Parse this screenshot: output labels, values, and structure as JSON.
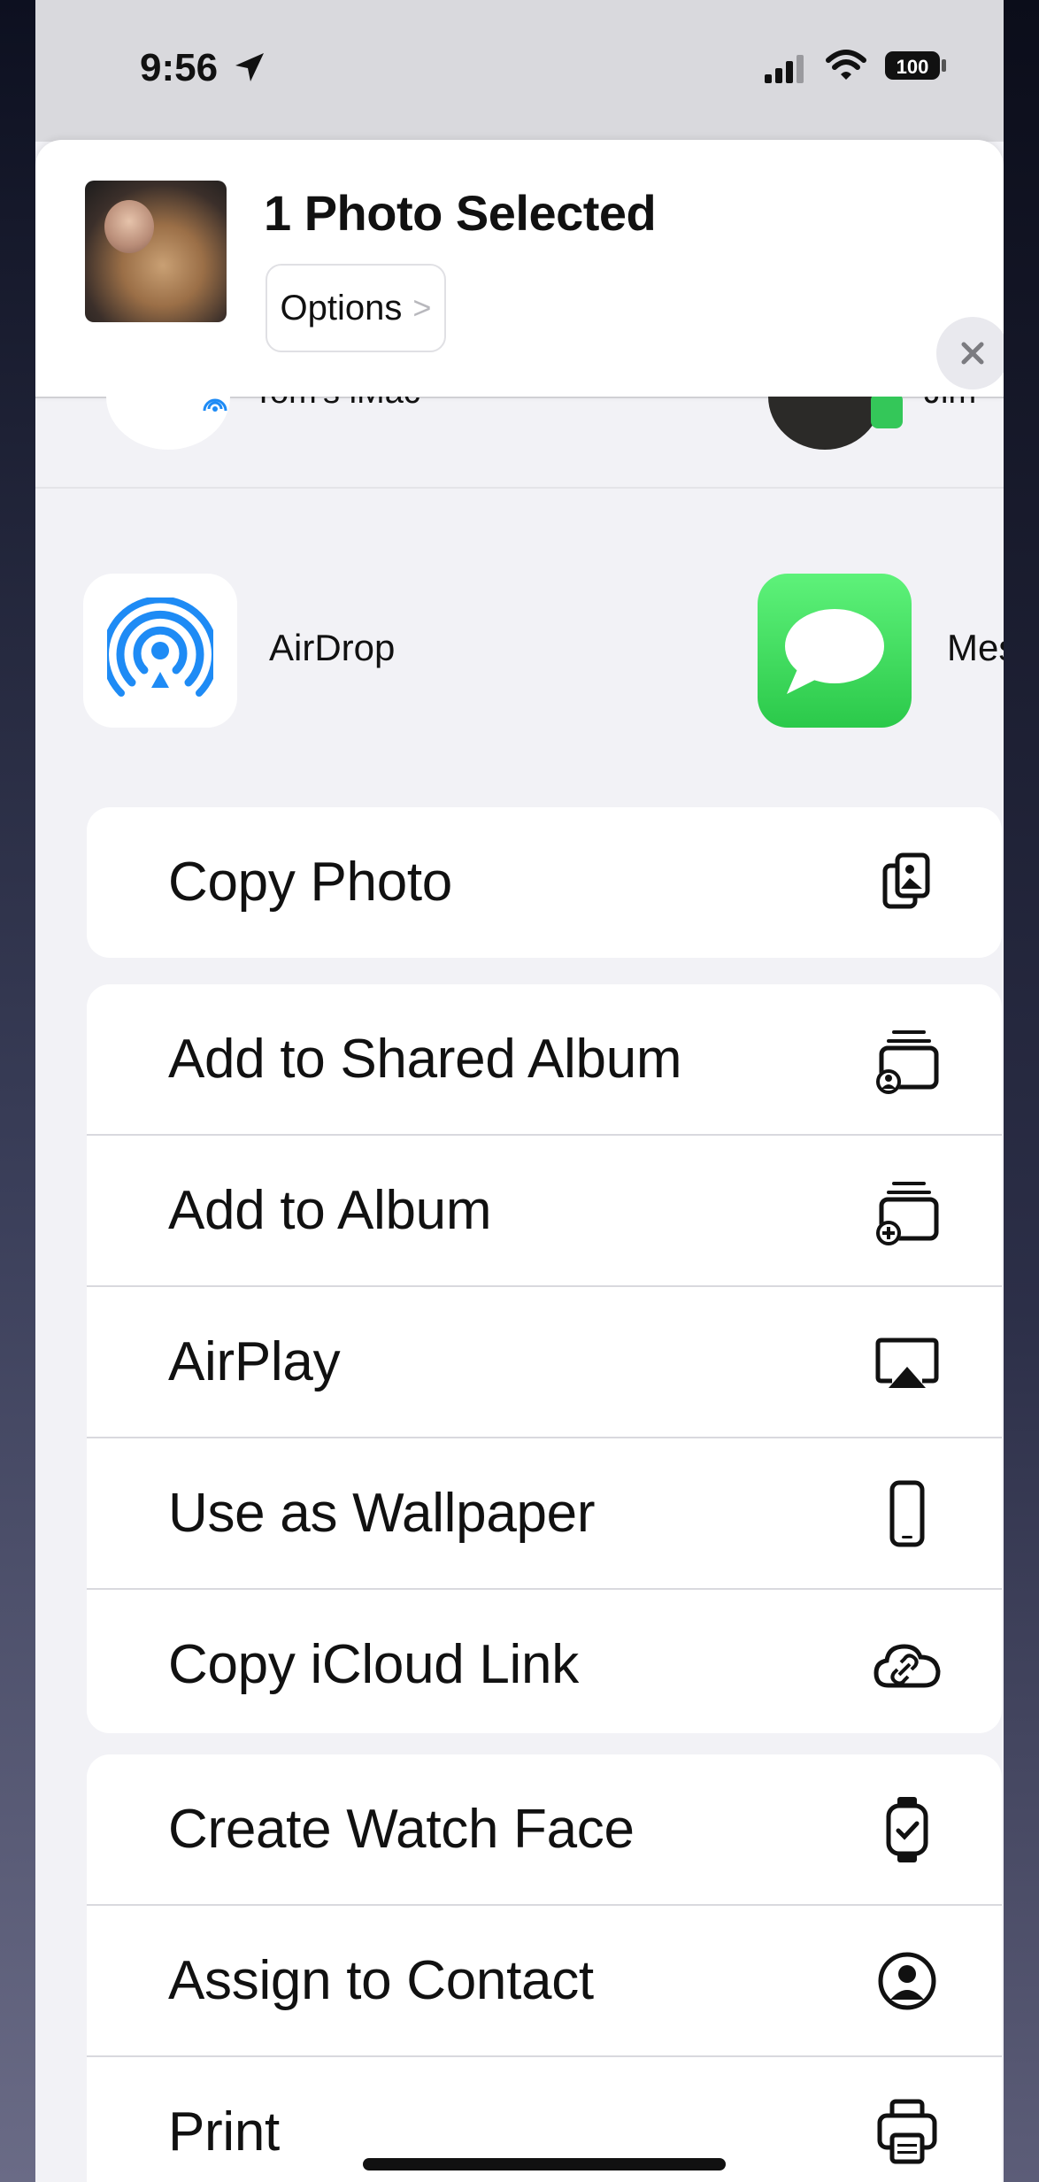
{
  "status_bar": {
    "time": "9:56",
    "battery": "100"
  },
  "share_header": {
    "title": "1 Photo Selected",
    "options_label": "Options",
    "options_chevron": ">"
  },
  "people": [
    {
      "label": "Tom's iMac"
    },
    {
      "label": "Jim"
    }
  ],
  "apps": [
    {
      "label": "AirDrop"
    },
    {
      "label": "Mess"
    }
  ],
  "actions": {
    "group1": [
      {
        "label": "Copy Photo",
        "icon": "copy-photo-icon"
      }
    ],
    "group2": [
      {
        "label": "Add to Shared Album",
        "icon": "shared-album-icon"
      },
      {
        "label": "Add to Album",
        "icon": "add-album-icon"
      },
      {
        "label": "AirPlay",
        "icon": "airplay-icon"
      },
      {
        "label": "Use as Wallpaper",
        "icon": "phone-icon"
      },
      {
        "label": "Copy iCloud Link",
        "icon": "icloud-link-icon"
      }
    ],
    "group3": [
      {
        "label": "Create Watch Face",
        "icon": "watch-icon"
      },
      {
        "label": "Assign to Contact",
        "icon": "contact-icon"
      },
      {
        "label": "Print",
        "icon": "printer-icon"
      }
    ]
  },
  "colors": {
    "messages_green": "#34c759",
    "airdrop_blue": "#1e8bf5",
    "sheet_bg": "#f2f2f6"
  }
}
